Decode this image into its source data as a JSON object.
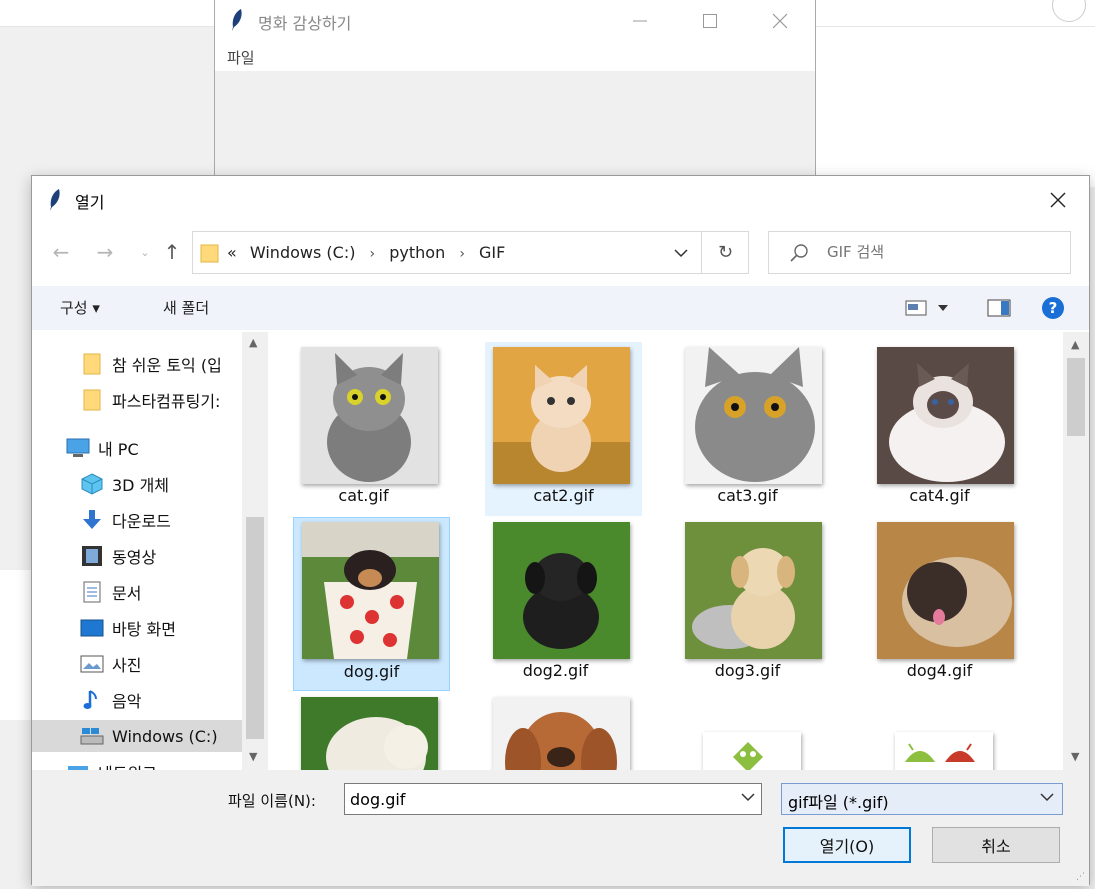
{
  "main_window": {
    "title": "명화 감상하기",
    "menu_file": "파일"
  },
  "dialog": {
    "title": "열기",
    "address": {
      "prefix": "«",
      "crumbs": [
        "Windows (C:)",
        "python",
        "GIF"
      ]
    },
    "search_placeholder": "GIF 검색",
    "toolbar": {
      "organize": "구성 ▾",
      "new_folder": "새 폴더"
    },
    "nav": {
      "items": [
        {
          "label": "참 쉬운 토익 (입",
          "icon": "folder-icon"
        },
        {
          "label": "파스타컴퓨팅기:",
          "icon": "folder-icon"
        },
        {
          "label": "내 PC",
          "icon": "pc-icon"
        },
        {
          "label": "3D 개체",
          "icon": "cube-icon"
        },
        {
          "label": "다운로드",
          "icon": "download-icon"
        },
        {
          "label": "동영상",
          "icon": "film-icon"
        },
        {
          "label": "문서",
          "icon": "document-icon"
        },
        {
          "label": "바탕 화면",
          "icon": "desktop-icon"
        },
        {
          "label": "사진",
          "icon": "picture-icon"
        },
        {
          "label": "음악",
          "icon": "music-icon"
        },
        {
          "label": "Windows (C:)",
          "icon": "drive-icon"
        },
        {
          "label": "네트워크",
          "icon": "network-icon"
        }
      ]
    },
    "files": [
      {
        "name": "cat.gif",
        "color": "#8d8d8d"
      },
      {
        "name": "cat2.gif",
        "color": "#d8a552"
      },
      {
        "name": "cat3.gif",
        "color": "#9a9a9a"
      },
      {
        "name": "cat4.gif",
        "color": "#b6a8a0"
      },
      {
        "name": "dog.gif",
        "color": "#c7503a"
      },
      {
        "name": "dog2.gif",
        "color": "#3f6b2a"
      },
      {
        "name": "dog3.gif",
        "color": "#d7c19a"
      },
      {
        "name": "dog4.gif",
        "color": "#a9834f"
      },
      {
        "name": "",
        "color": "#e8e4d8"
      },
      {
        "name": "",
        "color": "#b06a36"
      },
      {
        "name": "",
        "color": "#ffffff"
      },
      {
        "name": "",
        "color": "#ffffff"
      }
    ],
    "filename_label": "파일 이름(N):",
    "filename_value": "dog.gif",
    "filetype": "gif파일 (*.gif)",
    "open_button": "열기(O)",
    "cancel_button": "취소"
  }
}
